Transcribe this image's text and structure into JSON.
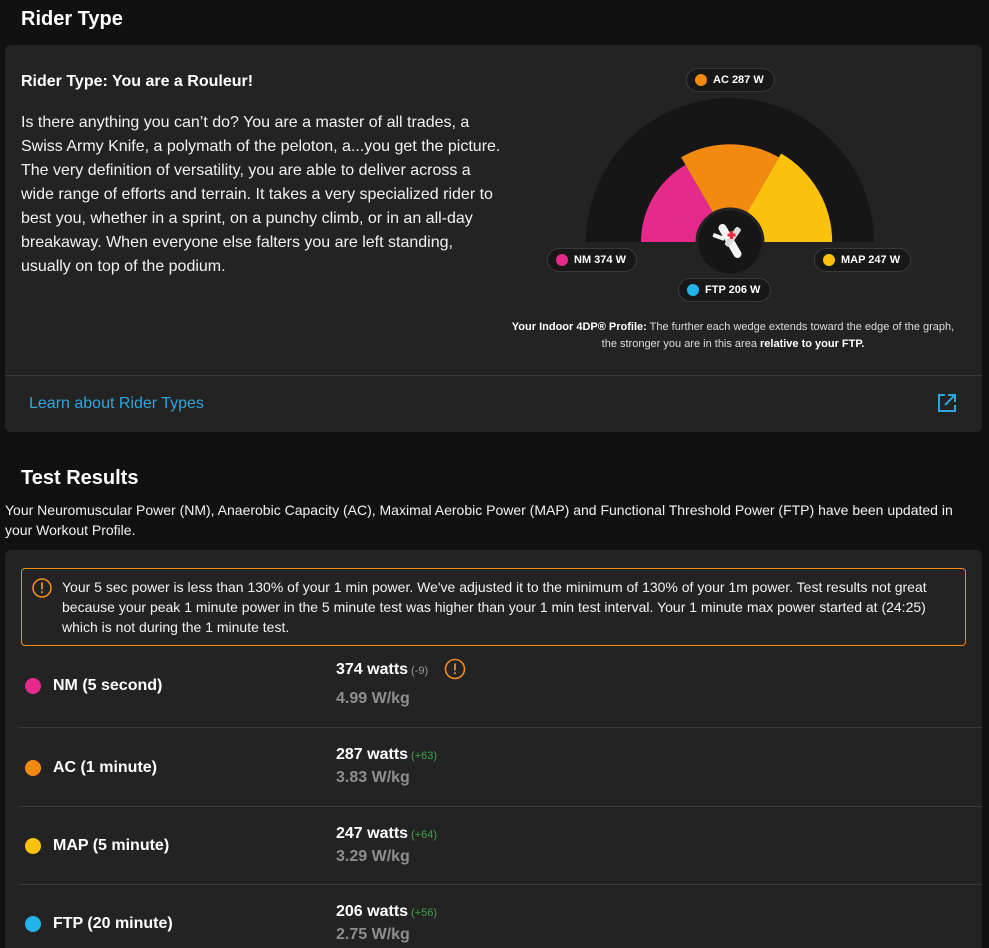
{
  "rider_type": {
    "section_title": "Rider Type",
    "heading": "Rider Type: You are a Rouleur!",
    "description": "Is there anything you can’t do? You are a master of all trades, a Swiss Army Knife, a polymath of the peloton, a...you get the picture. The very definition of versatility, you are able to deliver across a wide range of efforts and terrain. It takes a very specialized rider to best you, whether in a sprint, on a punchy climb, or in an all-day breakaway. When everyone else falters you are left standing, usually on top of the podium.",
    "gauge": {
      "icon": "swiss-army-knife-icon",
      "labels": {
        "ac": "AC 287 W",
        "nm": "NM 374 W",
        "map": "MAP 247 W",
        "ftp": "FTP 206 W"
      },
      "relative_strength": {
        "nm": 0.5,
        "ac": 0.58,
        "map": 0.62
      }
    },
    "profile_note_bold1": "Your Indoor 4DP® Profile:",
    "profile_note_text": " The further each wedge extends toward the edge of the graph, the stronger you are in this area ",
    "profile_note_bold2": "relative to your FTP.",
    "learn_link": "Learn about Rider Types",
    "external_icon": "external-link-icon"
  },
  "test_results": {
    "section_title": "Test Results",
    "description": "Your Neuromuscular Power (NM), Anaerobic Capacity (AC), Maximal Aerobic Power (MAP) and Functional Threshold Power (FTP) have been updated in your Workout Profile.",
    "warning": "Your 5 sec power is less than 130% of your 1 min power. We've adjusted it to the minimum of 130% of your 1m power. Test results not great because your peak 1 minute power in the 5 minute test was higher than your 1 min test interval. Your 1 minute max power started at (24:25) which is not during the 1 minute test.",
    "metrics": [
      {
        "label": "NM (5 second)",
        "watts": "374 watts",
        "delta": "(-9)",
        "wkg": "4.99 W/kg",
        "color": "#e62a8c"
      },
      {
        "label": "AC (1 minute)",
        "watts": "287 watts",
        "delta": "(+63)",
        "wkg": "3.83 W/kg",
        "color": "#f28a12"
      },
      {
        "label": "MAP (5 minute)",
        "watts": "247 watts",
        "delta": "(+64)",
        "wkg": "3.29 W/kg",
        "color": "#fcc10c"
      },
      {
        "label": "FTP (20 minute)",
        "watts": "206 watts",
        "delta": "(+56)",
        "wkg": "2.75 W/kg",
        "color": "#22b3e8"
      }
    ]
  },
  "colors": {
    "nm": "#e62a8c",
    "ac": "#f28a12",
    "map": "#fcc10c",
    "ftp": "#22b3e8",
    "warning": "#f08c1c",
    "link": "#2fa6dc",
    "positive_delta": "#3fa34d",
    "negative_delta": "#9a9a9a"
  }
}
